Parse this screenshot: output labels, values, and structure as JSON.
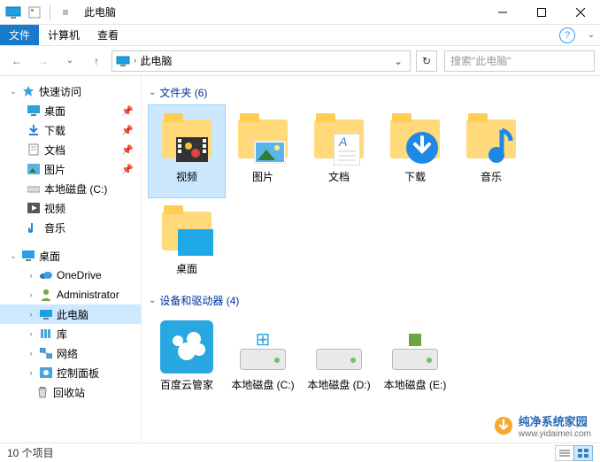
{
  "window": {
    "title": "此电脑",
    "menus": {
      "file": "文件",
      "computer": "计算机",
      "view": "查看"
    },
    "controls": {
      "min": "–",
      "max": "□",
      "close": "✕",
      "help": "?"
    }
  },
  "nav": {
    "address_label": "此电脑",
    "search_placeholder": "搜索\"此电脑\""
  },
  "sidebar": {
    "quick": {
      "label": "快速访问",
      "items": [
        {
          "label": "桌面",
          "pin": true,
          "icon": "desktop"
        },
        {
          "label": "下载",
          "pin": true,
          "icon": "download"
        },
        {
          "label": "文档",
          "pin": true,
          "icon": "document"
        },
        {
          "label": "图片",
          "pin": true,
          "icon": "picture"
        },
        {
          "label": "本地磁盘 (C:)",
          "pin": false,
          "icon": "drive"
        },
        {
          "label": "视频",
          "pin": false,
          "icon": "video"
        },
        {
          "label": "音乐",
          "pin": false,
          "icon": "music"
        }
      ]
    },
    "desktop": {
      "label": "桌面",
      "items": [
        {
          "label": "OneDrive",
          "icon": "onedrive"
        },
        {
          "label": "Administrator",
          "icon": "user"
        },
        {
          "label": "此电脑",
          "icon": "thispc",
          "selected": true
        },
        {
          "label": "库",
          "icon": "library"
        },
        {
          "label": "网络",
          "icon": "network"
        },
        {
          "label": "控制面板",
          "icon": "control"
        },
        {
          "label": "回收站",
          "icon": "recycle"
        }
      ]
    }
  },
  "sections": {
    "folders": {
      "title": "文件夹 (6)",
      "items": [
        {
          "label": "视频",
          "kind": "video",
          "selected": true
        },
        {
          "label": "图片",
          "kind": "picture"
        },
        {
          "label": "文档",
          "kind": "document"
        },
        {
          "label": "下载",
          "kind": "download"
        },
        {
          "label": "音乐",
          "kind": "music"
        },
        {
          "label": "桌面",
          "kind": "desktop"
        }
      ]
    },
    "drives": {
      "title": "设备和驱动器 (4)",
      "items": [
        {
          "label": "百度云管家",
          "kind": "baidu"
        },
        {
          "label": "本地磁盘 (C:)",
          "kind": "drive-c"
        },
        {
          "label": "本地磁盘 (D:)",
          "kind": "drive"
        },
        {
          "label": "本地磁盘 (E:)",
          "kind": "drive"
        }
      ]
    }
  },
  "status": {
    "text": "10 个项目"
  },
  "watermark": {
    "brand": "纯净系统家园",
    "url": "www.yidaimei.com"
  }
}
